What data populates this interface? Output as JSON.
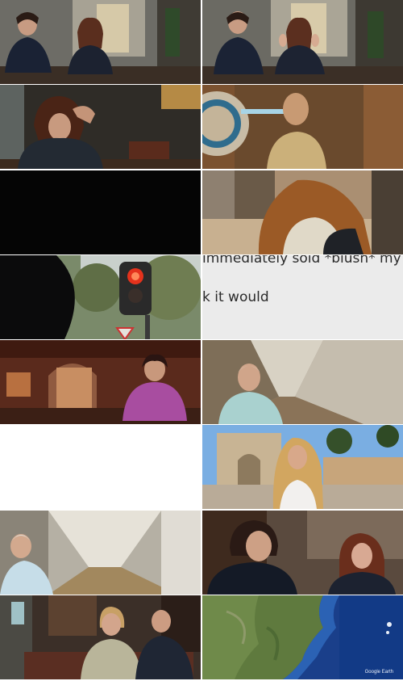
{
  "captions": {
    "line1": "immediately sold *blush* my",
    "line2": "k it would"
  },
  "map": {
    "credit": "Google Earth"
  }
}
